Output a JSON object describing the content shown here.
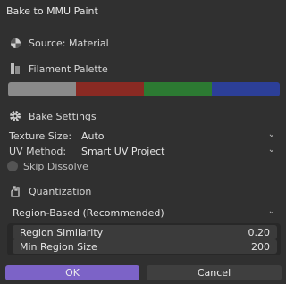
{
  "dialog": {
    "title": "Bake to MMU Paint"
  },
  "source": {
    "label": "Source: Material",
    "icon": "material-sphere-icon"
  },
  "palette": {
    "label": "Filament Palette",
    "icon": "palette-icon",
    "colors": [
      "#8a8a8a",
      "#8a2a23",
      "#2c7a32",
      "#2c3f98"
    ]
  },
  "bake_settings": {
    "label": "Bake Settings",
    "icon": "gear-icon",
    "texture_size": {
      "label": "Texture Size:",
      "value": "Auto"
    },
    "uv_method": {
      "label": "UV Method:",
      "value": "Smart UV Project"
    },
    "skip_dissolve": {
      "label": "Skip Dissolve",
      "checked": false
    }
  },
  "quantization": {
    "label": "Quantization",
    "icon": "quantize-icon",
    "mode": "Region-Based (Recommended)",
    "region_similarity": {
      "label": "Region Similarity",
      "value": "0.20"
    },
    "min_region_size": {
      "label": "Min Region Size",
      "value": "200"
    }
  },
  "buttons": {
    "ok": "OK",
    "cancel": "Cancel"
  },
  "colors": {
    "accent": "#7c63c7",
    "background": "#303030"
  }
}
